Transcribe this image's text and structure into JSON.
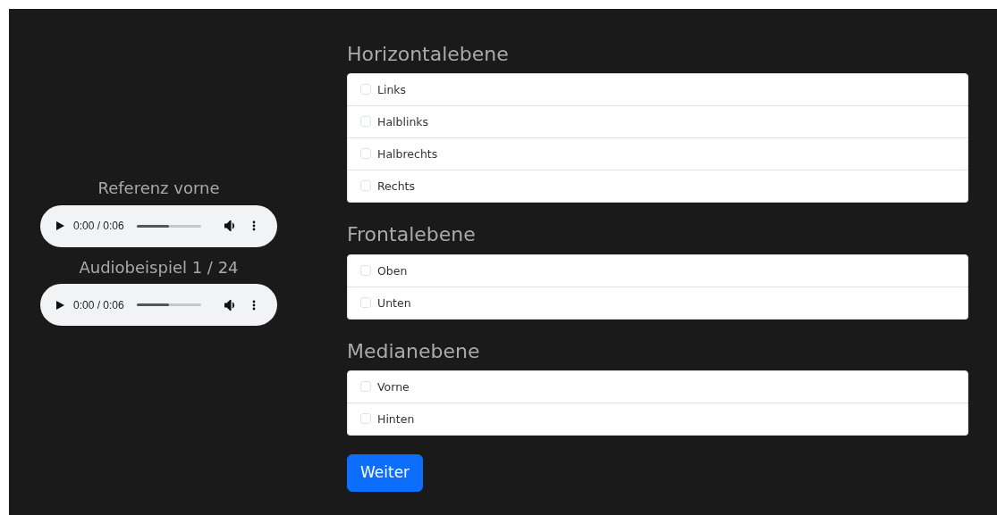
{
  "players": [
    {
      "title": "Referenz vorne",
      "time": "0:00 / 0:06",
      "level": 0.5
    },
    {
      "title": "Audiobeispiel 1 / 24",
      "time": "0:00 / 0:06",
      "level": 0.5
    }
  ],
  "groups": [
    {
      "heading": "Horizontalebene",
      "options": [
        {
          "label": "Links",
          "checked": false
        },
        {
          "label": "Halblinks",
          "checked": false
        },
        {
          "label": "Halbrechts",
          "checked": false
        },
        {
          "label": "Rechts",
          "checked": false
        }
      ]
    },
    {
      "heading": "Frontalebene",
      "options": [
        {
          "label": "Oben",
          "checked": false
        },
        {
          "label": "Unten",
          "checked": false
        }
      ]
    },
    {
      "heading": "Medianebene",
      "options": [
        {
          "label": "Vorne",
          "checked": false
        },
        {
          "label": "Hinten",
          "checked": false
        }
      ]
    }
  ],
  "button": "Weiter"
}
